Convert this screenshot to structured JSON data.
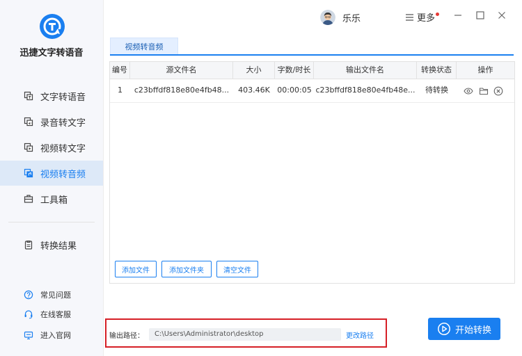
{
  "app": {
    "name": "迅捷文字转语音"
  },
  "sidebar": {
    "items": [
      {
        "label": "文字转语音",
        "icon": "text-to-speech-icon"
      },
      {
        "label": "录音转文字",
        "icon": "recording-to-text-icon"
      },
      {
        "label": "视频转文字",
        "icon": "video-to-text-icon"
      },
      {
        "label": "视频转音频",
        "icon": "video-to-audio-icon",
        "active": true
      },
      {
        "label": "工具箱",
        "icon": "toolbox-icon"
      },
      {
        "label": "转换结果",
        "icon": "results-icon"
      }
    ],
    "links": [
      {
        "label": "常见问题",
        "icon": "question-icon"
      },
      {
        "label": "在线客服",
        "icon": "headset-icon"
      },
      {
        "label": "进入官网",
        "icon": "monitor-icon"
      }
    ]
  },
  "header": {
    "username": "乐乐",
    "more_label": "更多"
  },
  "tab": {
    "label": "视频转音频"
  },
  "table": {
    "columns": [
      "编号",
      "源文件名",
      "大小",
      "字数/时长",
      "输出文件名",
      "转换状态",
      "操作"
    ],
    "rows": [
      {
        "index": "1",
        "source": "c23bffdf818e80e4fb48...",
        "size": "403.46K",
        "duration": "00:00:05",
        "output": "c23bffdf818e80e4fb48e...",
        "status": "待转换"
      }
    ]
  },
  "buttons": {
    "add_file": "添加文件",
    "add_folder": "添加文件夹",
    "clear": "清空文件"
  },
  "output": {
    "label": "输出路径：",
    "path": "C:\\Users\\Administrator\\desktop",
    "change": "更改路径"
  },
  "start": {
    "label": "开始转换"
  },
  "colors": {
    "accent": "#1a7ff0",
    "highlight": "#d61f26",
    "notify_dot": "#e53935"
  }
}
